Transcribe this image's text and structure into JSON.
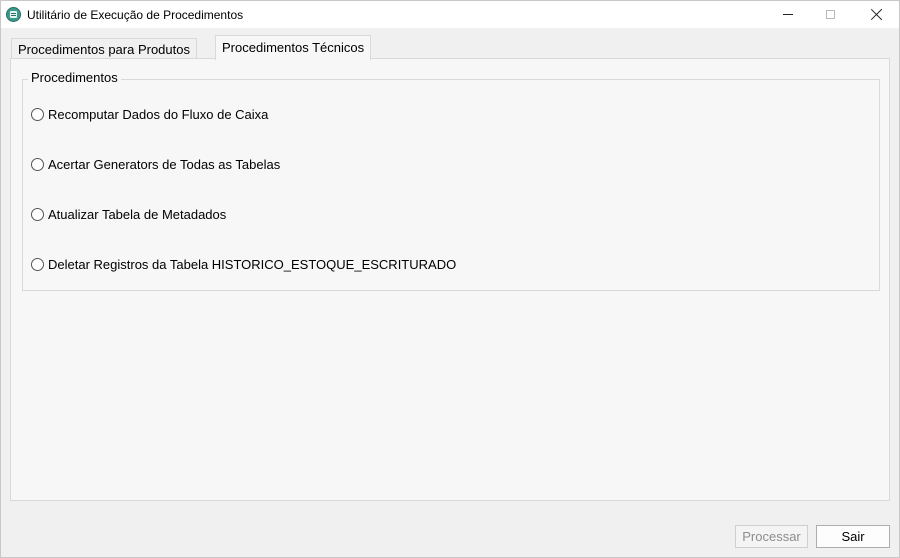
{
  "window": {
    "title": "Utilitário de Execução de Procedimentos"
  },
  "tabs": [
    {
      "label": "Procedimentos para Produtos",
      "active": false
    },
    {
      "label": "Procedimentos Técnicos",
      "active": true
    }
  ],
  "group": {
    "title": "Procedimentos",
    "options": [
      {
        "label": "Recomputar Dados do Fluxo de Caixa",
        "selected": false
      },
      {
        "label": "Acertar Generators de Todas as Tabelas",
        "selected": false
      },
      {
        "label": "Atualizar Tabela de Metadados",
        "selected": false
      },
      {
        "label": "Deletar Registros da Tabela HISTORICO_ESTOQUE_ESCRITURADO",
        "selected": false
      }
    ]
  },
  "buttons": {
    "process_label": "Processar",
    "process_enabled": false,
    "exit_label": "Sair"
  }
}
